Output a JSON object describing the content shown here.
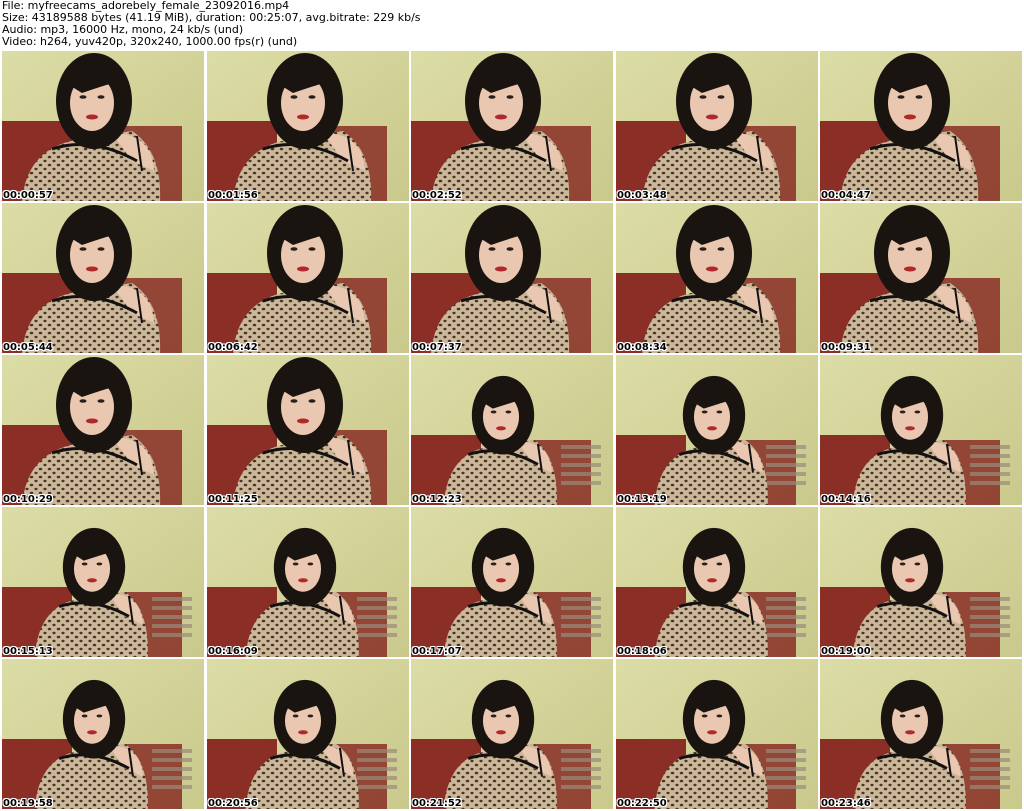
{
  "header": {
    "file_line": "File: myfreecams_adorebely_female_23092016.mp4",
    "size_line": "Size: 43189588 bytes (41.19 MiB), duration: 00:25:07, avg.bitrate: 229 kb/s",
    "audio_line": "Audio: mp3, 16000 Hz, mono, 24 kb/s (und)",
    "video_line": "Video: h264, yuv420p, 320x240, 1000.00 fps(r) (und)"
  },
  "thumbnails": [
    {
      "time": "00:00:57"
    },
    {
      "time": "00:01:56"
    },
    {
      "time": "00:02:52"
    },
    {
      "time": "00:03:48"
    },
    {
      "time": "00:04:47"
    },
    {
      "time": "00:05:44"
    },
    {
      "time": "00:06:42"
    },
    {
      "time": "00:07:37"
    },
    {
      "time": "00:08:34"
    },
    {
      "time": "00:09:31"
    },
    {
      "time": "00:10:29"
    },
    {
      "time": "00:11:25"
    },
    {
      "time": "00:12:23"
    },
    {
      "time": "00:13:19"
    },
    {
      "time": "00:14:16"
    },
    {
      "time": "00:15:13"
    },
    {
      "time": "00:16:09"
    },
    {
      "time": "00:17:07"
    },
    {
      "time": "00:18:06"
    },
    {
      "time": "00:19:00"
    },
    {
      "time": "00:19:58"
    },
    {
      "time": "00:20:56"
    },
    {
      "time": "00:21:52"
    },
    {
      "time": "00:22:50"
    },
    {
      "time": "00:23:46"
    }
  ],
  "colors": {
    "wall": "#c9c98c",
    "wall_light": "#dcdca6",
    "couch": "#8a2e26",
    "hair": "#1a1410",
    "skin": "#e9c7b0",
    "top": "#cbb79a",
    "spots": "#4a3424",
    "lips": "#b0282a"
  }
}
